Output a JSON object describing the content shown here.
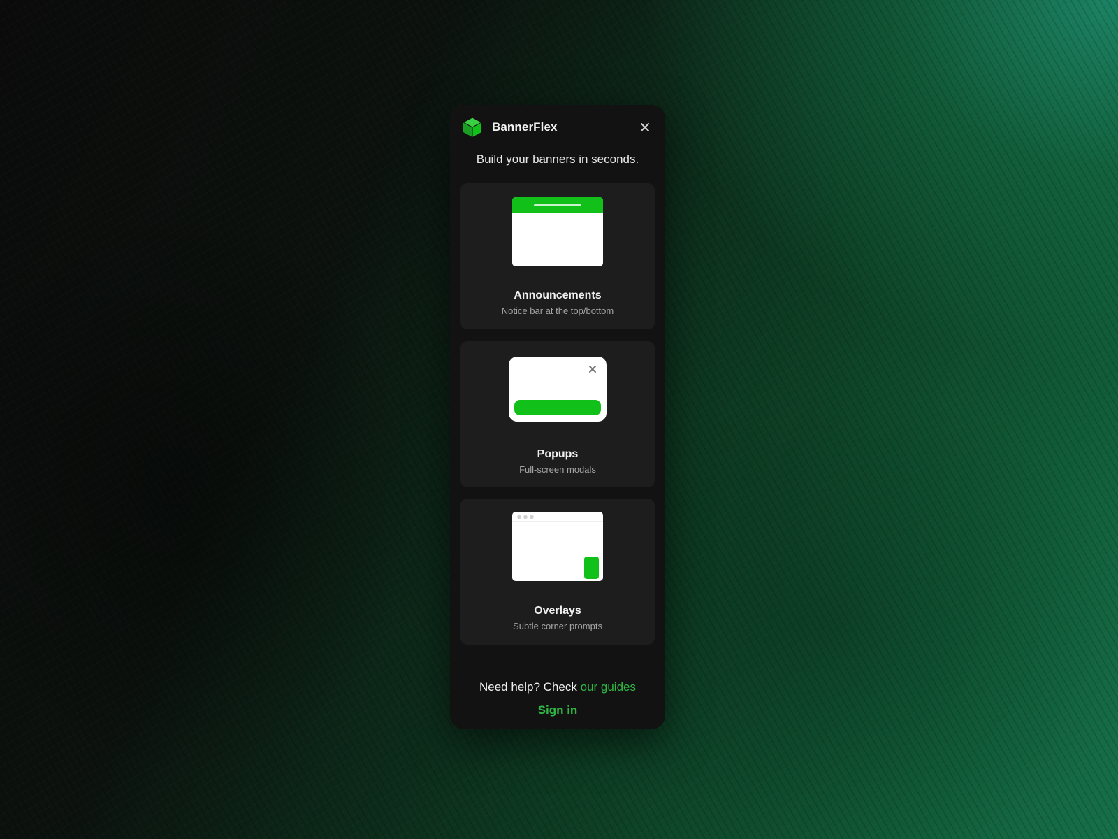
{
  "app": {
    "name": "BannerFlex",
    "tagline": "Build your banners in seconds."
  },
  "icons": {
    "logo": "cube-icon",
    "close": "close-icon"
  },
  "colors": {
    "accent": "#11c11a",
    "panel_bg": "#121212",
    "card_bg": "#1d1d1d",
    "link": "#2fb844"
  },
  "cards": [
    {
      "title": "Announcements",
      "subtitle": "Notice bar at the top/bottom"
    },
    {
      "title": "Popups",
      "subtitle": "Full-screen modals"
    },
    {
      "title": "Overlays",
      "subtitle": "Subtle corner prompts"
    }
  ],
  "footer": {
    "help_text": "Need help? Check",
    "help_link": "our guides",
    "signin": "Sign in"
  }
}
